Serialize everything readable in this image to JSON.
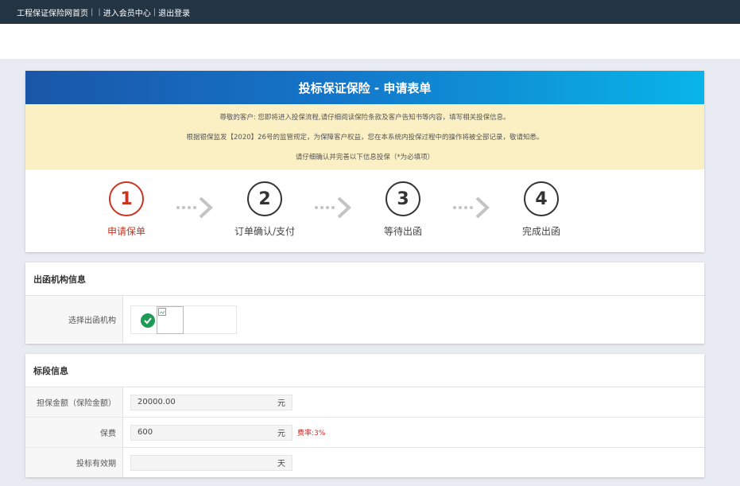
{
  "nav": {
    "home": "工程保证保险网首页",
    "member_center": "进入会员中心",
    "logout": "退出登录",
    "separator": "|"
  },
  "header": {
    "title": "投标保证保险 - 申请表单"
  },
  "notice": {
    "line1": "尊敬的客户: 您即将进入投保流程,请仔细阅读保险条款及客户告知书等内容，填写相关投保信息。",
    "line2": "根据银保监发【2020】26号的监管规定，为保障客户权益，您在本系统内投保过程中的操作将被全部记录，敬请知悉。",
    "line3": "请仔细确认并完善以下信息投保（*为必填项）"
  },
  "steps": [
    {
      "num": "1",
      "label": "申请保单",
      "active": true
    },
    {
      "num": "2",
      "label": "订单确认/支付",
      "active": false
    },
    {
      "num": "3",
      "label": "等待出函",
      "active": false
    },
    {
      "num": "4",
      "label": "完成出函",
      "active": false
    }
  ],
  "org_section": {
    "title": "出函机构信息",
    "select_label": "选择出函机构"
  },
  "bid_section": {
    "title": "标段信息",
    "fields": [
      {
        "label": "担保金额（保险金额）",
        "value": "20000.00",
        "unit": "元"
      },
      {
        "label": "保费",
        "value": "600",
        "unit": "元",
        "note": "费率:3%"
      },
      {
        "label": "投标有效期",
        "value": "",
        "unit": "天"
      }
    ]
  },
  "colors": {
    "topbar": "#233443",
    "accent_red": "#c8341f",
    "header_blue": "#1475c9",
    "notice_bg": "#fbf0c4",
    "check_green": "#1f9b55"
  }
}
